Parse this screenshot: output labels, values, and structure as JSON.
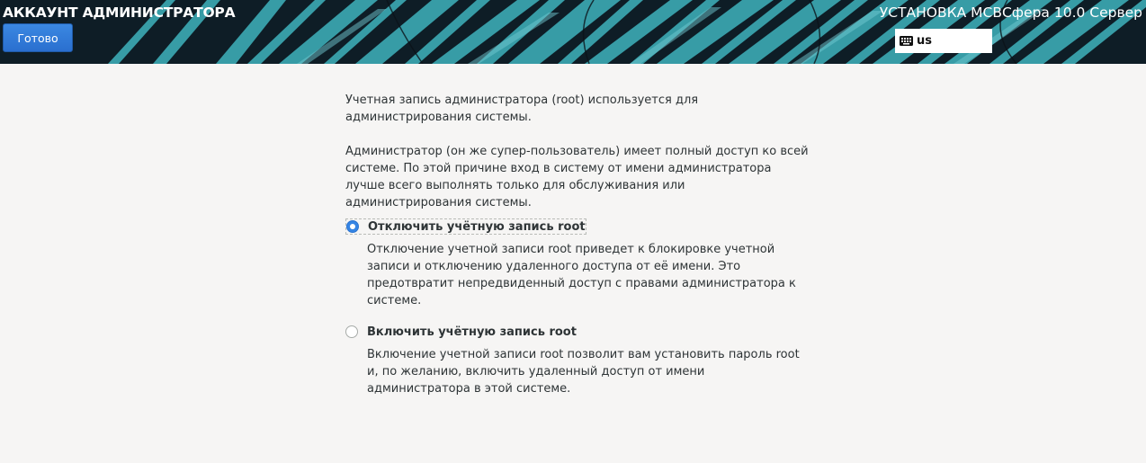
{
  "header": {
    "page_title": "АККАУНТ АДМИНИСТРАТОРА",
    "done_button": "Готово",
    "product_title": "УСТАНОВКА МСВСфера 10.0 Сервер",
    "keyboard_layout": "us",
    "keyboard_icon": "keyboard-icon"
  },
  "main": {
    "intro": "Учетная запись администратора (root) используется для администрирования системы.",
    "warning": "Администратор (он же супер-пользователь) имеет полный доступ ко всей системе. По этой причине вход в систему от имени администратора лучше всего выполнять только для обслуживания или администрирования системы.",
    "options": [
      {
        "label": "Отключить учётную запись root",
        "description": "Отключение учетной записи root приведет к блокировке учетной записи и отключению удаленного доступа от её имени. Это предотвратит непредвиденный доступ с правами администратора к системе.",
        "selected": true
      },
      {
        "label": "Включить учётную запись root",
        "description": "Включение учетной записи root позволит вам установить пароль root и, по желанию, включить удаленный доступ от имени администратора в этой системе.",
        "selected": false
      }
    ]
  },
  "colors": {
    "accent": "#3584e4",
    "button": "#2f7bd9",
    "background": "#f6f5f4",
    "text": "#2e3436",
    "banner_teal": "#3aa3ad"
  }
}
